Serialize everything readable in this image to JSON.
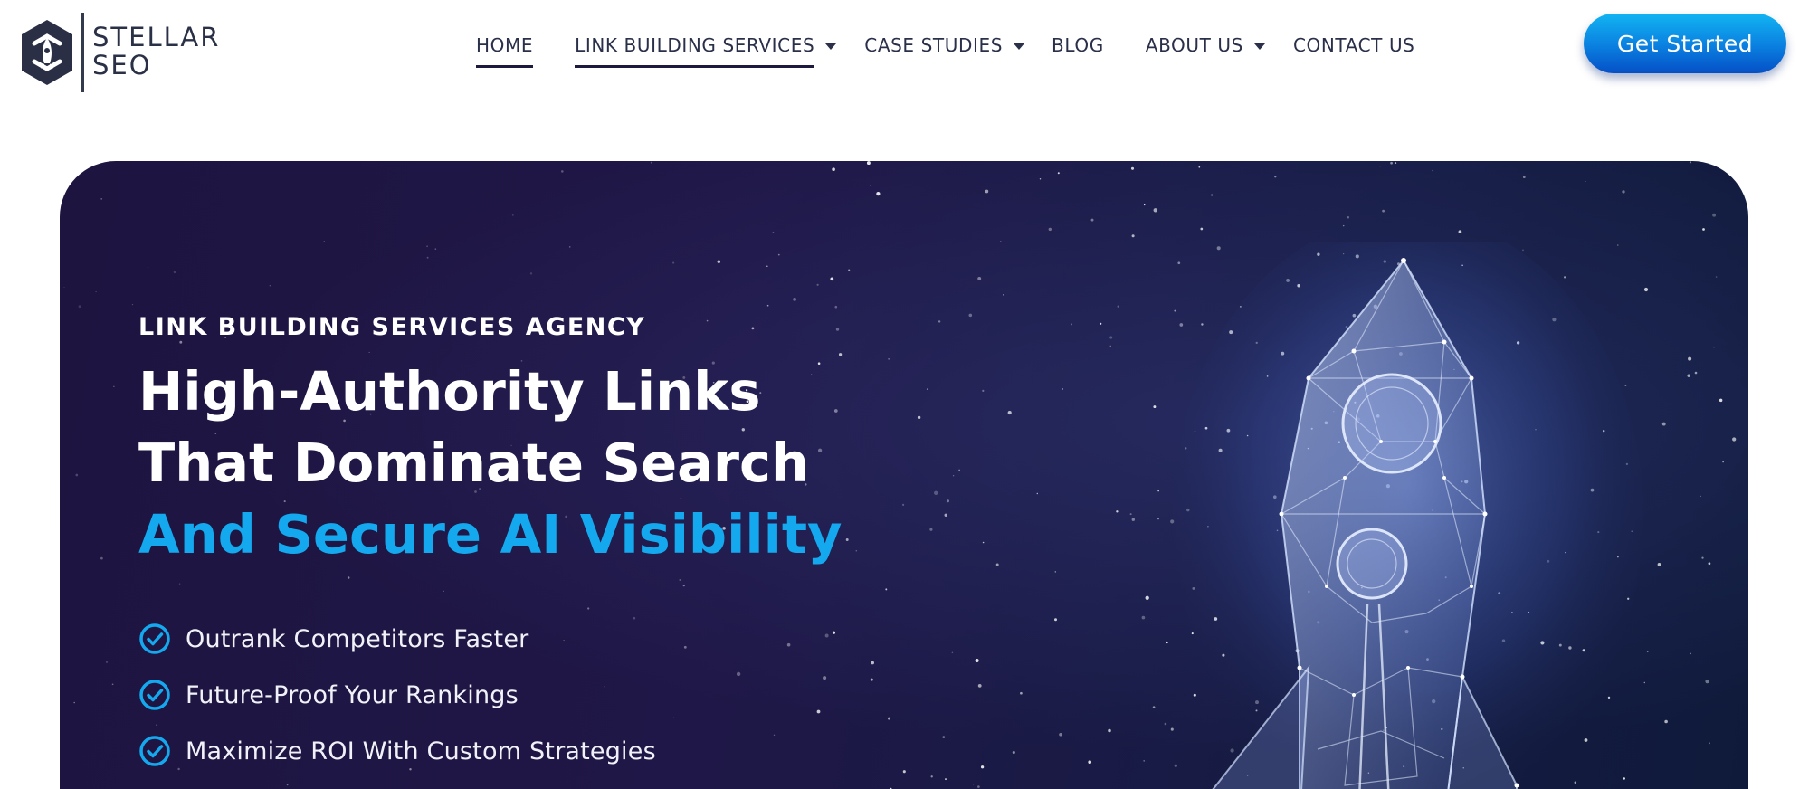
{
  "header": {
    "logo": {
      "line1": "STELLAR",
      "line2": "SEO",
      "icon": "rocket-hexagon-icon"
    },
    "nav": [
      {
        "label": "HOME",
        "active": true,
        "dropdown": false
      },
      {
        "label": "LINK BUILDING SERVICES",
        "active": true,
        "dropdown": true
      },
      {
        "label": "CASE STUDIES",
        "active": false,
        "dropdown": true
      },
      {
        "label": "BLOG",
        "active": false,
        "dropdown": false
      },
      {
        "label": "ABOUT US",
        "active": false,
        "dropdown": true
      },
      {
        "label": "CONTACT US",
        "active": false,
        "dropdown": false
      }
    ],
    "cta_label": "Get Started"
  },
  "hero": {
    "eyebrow": "LINK BUILDING SERVICES AGENCY",
    "headline_line1": "High-Authority Links",
    "headline_line2": "That Dominate Search",
    "headline_line3": "And Secure AI Visibility",
    "benefits": [
      "Outrank Competitors Faster",
      "Future-Proof Your Rankings",
      "Maximize ROI With Custom Strategies"
    ],
    "check_icon": "check-circle-icon",
    "illustration": "wireframe-rocket-illustration"
  },
  "colors": {
    "accent": "#14a9ef",
    "hero_background": "#1f1747",
    "nav_text": "#2a3049",
    "cta_gradient_top": "#12b4f2",
    "cta_gradient_bottom": "#0550c6",
    "white": "#ffffff"
  }
}
